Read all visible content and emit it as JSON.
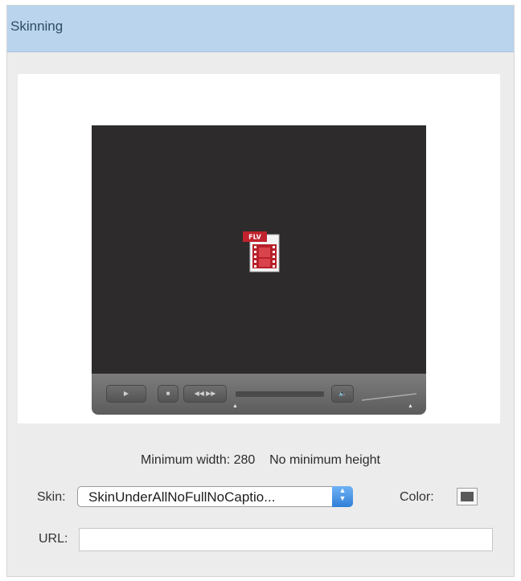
{
  "window": {
    "title": "Skinning"
  },
  "preview": {
    "icon": "flv-file-icon",
    "icon_badge": "FLV",
    "controls": {
      "play_icon": "play-icon",
      "stop_icon": "stop-icon",
      "rewind_icon": "rewind-icon",
      "forward_icon": "fast-forward-icon",
      "seek_bar": "seek-bar",
      "mute_icon": "speaker-icon",
      "volume_slider": "volume-slider",
      "control_bar_color": "#6a6a6a"
    },
    "video_background": "#2d2b2b"
  },
  "info": {
    "min_width": "Minimum width: 280",
    "min_height": "No minimum height"
  },
  "skin": {
    "label": "Skin:",
    "value": "SkinUnderAllNoFullNoCaptio...",
    "stepper_icon": "up-down-arrows-icon"
  },
  "color": {
    "label": "Color:",
    "value": "#5a5a5a"
  },
  "url": {
    "label": "URL:",
    "value": ""
  },
  "colors": {
    "titlebar": "#b9d4ec",
    "accent": "#2f7fd8"
  }
}
